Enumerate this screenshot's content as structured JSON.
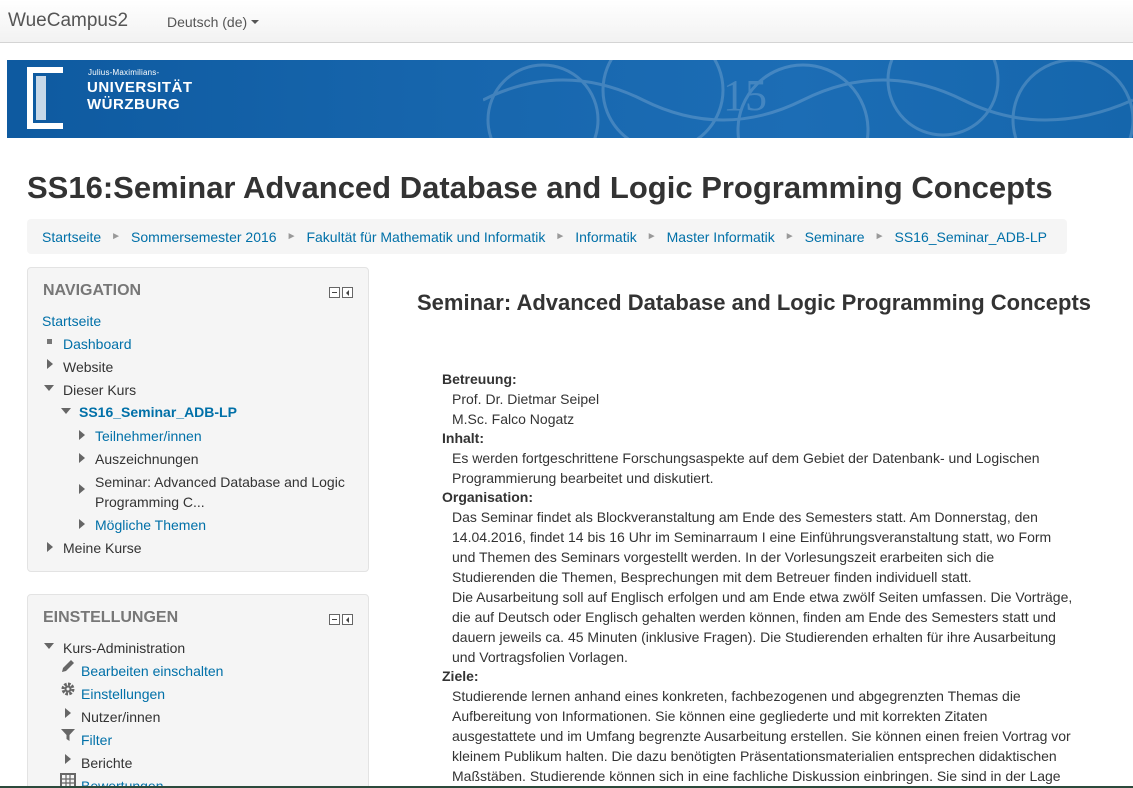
{
  "navbar": {
    "brand": "WueCampus2",
    "language": "Deutsch (de)"
  },
  "banner": {
    "logo_small": "Julius-Maximilians-",
    "logo_line1": "UNIVERSITÄT",
    "logo_line2": "WÜRZBURG"
  },
  "page": {
    "title": "SS16:Seminar Advanced Database and Logic Programming Concepts"
  },
  "breadcrumb": [
    "Startseite",
    "Sommersemester 2016",
    "Fakultät für Mathematik und Informatik",
    "Informatik",
    "Master Informatik",
    "Seminare",
    "SS16_Seminar_ADB-LP"
  ],
  "navigation": {
    "title": "NAVIGATION",
    "home": "Startseite",
    "dashboard": "Dashboard",
    "website": "Website",
    "this_course": "Dieser Kurs",
    "course": "SS16_Seminar_ADB-LP",
    "participants": "Teilnehmer/innen",
    "badges": "Auszeichnungen",
    "section_line1": "Seminar: Advanced Database and Logic",
    "section_line2": "Programming C...",
    "topics": "Mögliche Themen",
    "my_courses": "Meine Kurse"
  },
  "settings": {
    "title": "EINSTELLUNGEN",
    "course_admin": "Kurs-Administration",
    "edit_on": "Bearbeiten einschalten",
    "settings": "Einstellungen",
    "users": "Nutzer/innen",
    "filter": "Filter",
    "reports": "Berichte",
    "grades": "Bewertungen"
  },
  "main": {
    "heading": "Seminar: Advanced Database and Logic Programming Concepts",
    "supervision_label": "Betreuung:",
    "supervisor1": "Prof. Dr. Dietmar Seipel",
    "supervisor2": "M.Sc. Falco Nogatz",
    "content_label": "Inhalt:",
    "content_l1": "Es werden fortgeschrittene Forschungsaspekte auf dem Gebiet der Datenbank- und Logischen",
    "content_l2": "Programmierung bearbeitet und diskutiert.",
    "org_label": "Organisation:",
    "org_l1": "Das Seminar findet als Blockveranstaltung am Ende des Semesters statt. Am Donnerstag, den",
    "org_l2": "14.04.2016, findet 14 bis 16 Uhr im Seminarraum I eine Einführungsveranstaltung statt, wo Form",
    "org_l3": "und Themen des Seminars vorgestellt werden. In der Vorlesungszeit erarbeiten sich die",
    "org_l4": "Studierenden die Themen, Besprechungen mit dem Betreuer finden individuell statt.",
    "org_l5": "Die Ausarbeitung soll auf Englisch erfolgen und am Ende etwa zwölf Seiten umfassen. Die Vorträge,",
    "org_l6": "die auf Deutsch oder Englisch gehalten werden können, finden am Ende des Semesters statt und",
    "org_l7": "dauern jeweils ca. 45 Minuten (inklusive Fragen). Die Studierenden erhalten für ihre Ausarbeitung",
    "org_l8": "und Vortragsfolien Vorlagen.",
    "goals_label": "Ziele:",
    "goals_l1": "Studierende lernen anhand eines konkreten, fachbezogenen und abgegrenzten Themas die",
    "goals_l2": "Aufbereitung von Informationen. Sie können eine gegliederte und mit korrekten Zitaten",
    "goals_l3": "ausgestattete und im Umfang begrenzte Ausarbeitung erstellen. Sie können einen freien Vortrag vor",
    "goals_l4": "kleinem Publikum halten. Die dazu benötigten Präsentationsmaterialien entsprechen didaktischen",
    "goals_l5": "Maßstäben. Studierende können sich in eine fachliche Diskussion einbringen. Sie sind in der Lage"
  }
}
